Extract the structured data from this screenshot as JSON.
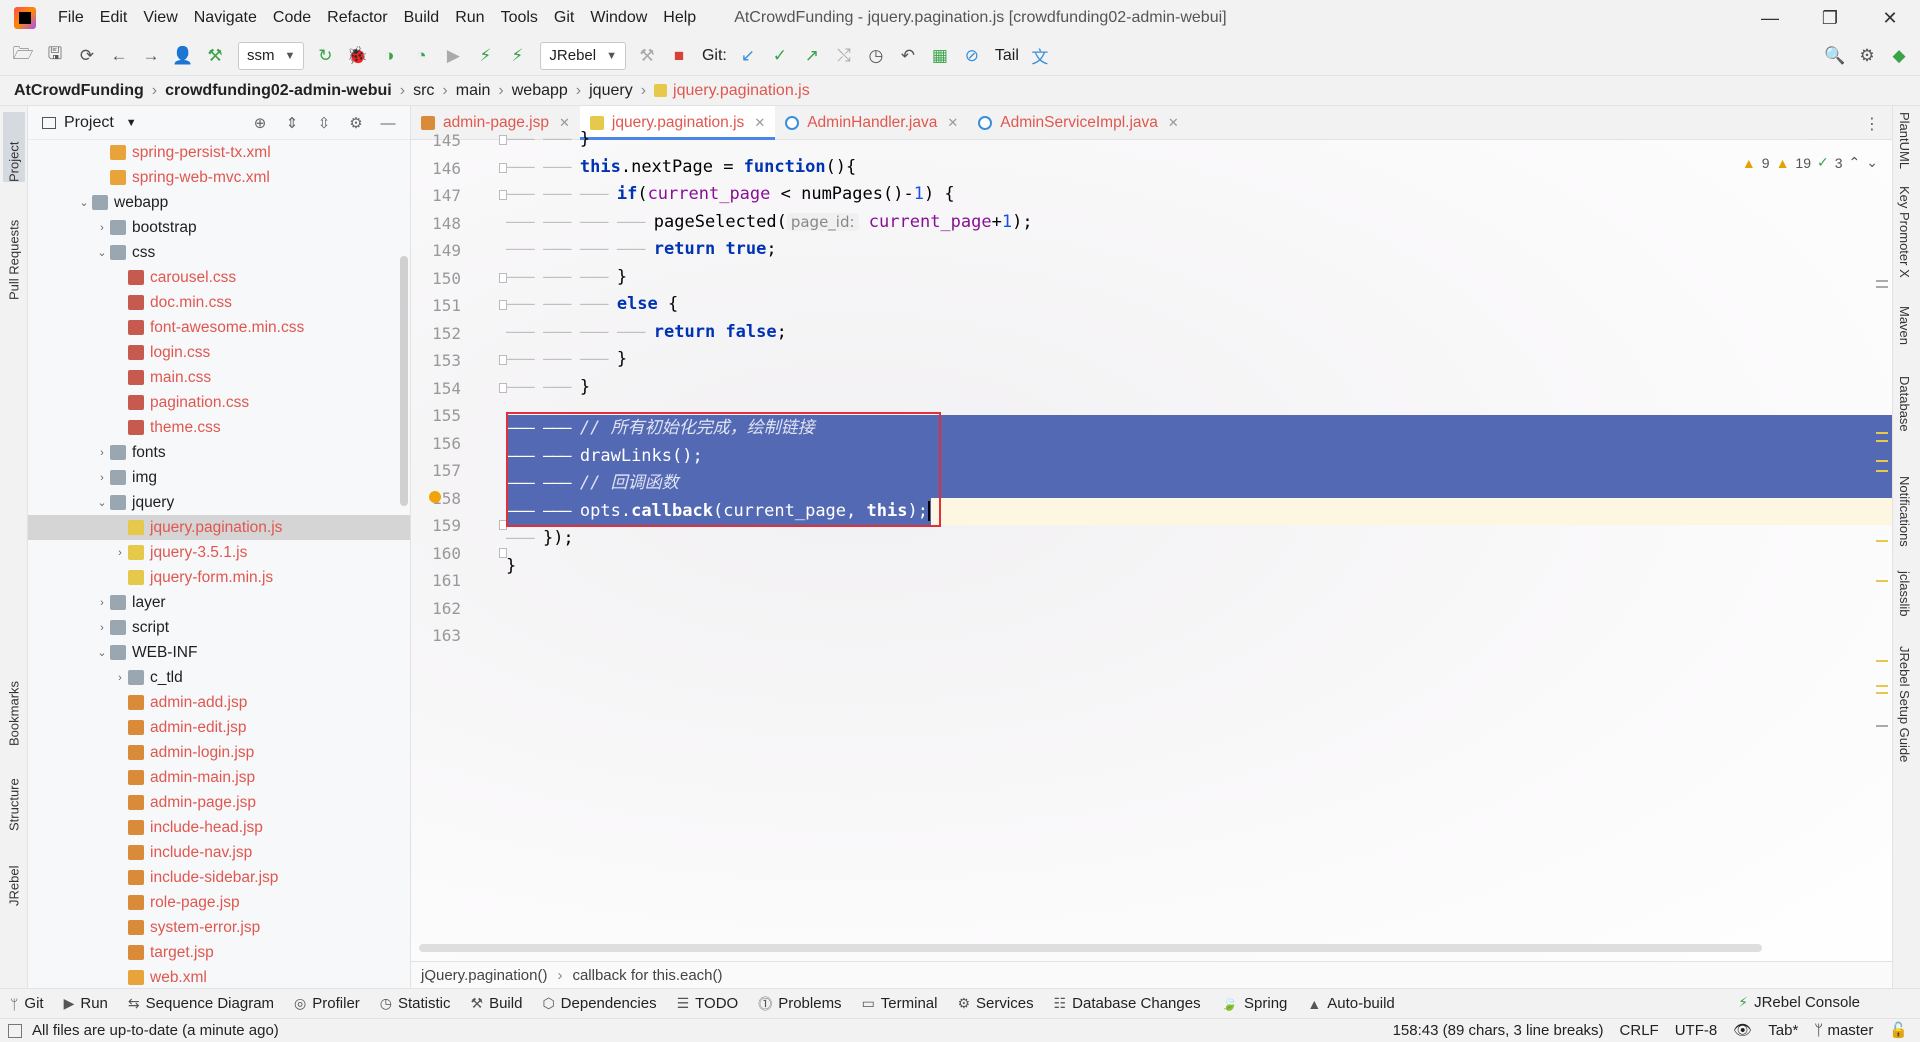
{
  "menubar": {
    "items": [
      "File",
      "Edit",
      "View",
      "Navigate",
      "Code",
      "Refactor",
      "Build",
      "Run",
      "Tools",
      "Git",
      "Window",
      "Help"
    ],
    "window_title": "AtCrowdFunding - jquery.pagination.js [crowdfunding02-admin-webui]"
  },
  "toolbar": {
    "run_config": "ssm",
    "jrebel": "JRebel",
    "git_label": "Git:",
    "tail_label": "Tail"
  },
  "breadcrumb": {
    "items": [
      "AtCrowdFunding",
      "crowdfunding02-admin-webui",
      "src",
      "main",
      "webapp",
      "jquery",
      "jquery.pagination.js"
    ]
  },
  "left_strip": {
    "project": "Project",
    "pull_requests": "Pull Requests",
    "bookmarks": "Bookmarks",
    "structure": "Structure",
    "jrebel": "JRebel"
  },
  "right_strip": {
    "items": [
      "PlantUML",
      "Key Promoter X",
      "Maven",
      "Database",
      "Notifications",
      "jclasslib",
      "JRebel Setup Guide"
    ]
  },
  "project_panel": {
    "title": "Project",
    "tree": [
      {
        "name": "spring-persist-tx.xml",
        "icon": "xml",
        "red": true
      },
      {
        "name": "spring-web-mvc.xml",
        "icon": "xml",
        "red": true
      },
      {
        "name": "webapp",
        "icon": "folder",
        "red": false,
        "arrow": "expanded"
      },
      {
        "name": "bootstrap",
        "icon": "folder",
        "red": false,
        "arrow": "collapsed"
      },
      {
        "name": "css",
        "icon": "folder",
        "red": false,
        "arrow": "expanded"
      },
      {
        "name": "carousel.css",
        "icon": "css",
        "red": true
      },
      {
        "name": "doc.min.css",
        "icon": "css",
        "red": true
      },
      {
        "name": "font-awesome.min.css",
        "icon": "css",
        "red": true
      },
      {
        "name": "login.css",
        "icon": "css",
        "red": true
      },
      {
        "name": "main.css",
        "icon": "css",
        "red": true
      },
      {
        "name": "pagination.css",
        "icon": "css",
        "red": true
      },
      {
        "name": "theme.css",
        "icon": "css",
        "red": true
      },
      {
        "name": "fonts",
        "icon": "folder",
        "red": false,
        "arrow": "collapsed"
      },
      {
        "name": "img",
        "icon": "folder",
        "red": false,
        "arrow": "collapsed"
      },
      {
        "name": "jquery",
        "icon": "folder",
        "red": false,
        "arrow": "expanded"
      },
      {
        "name": "jquery.pagination.js",
        "icon": "js",
        "red": true,
        "selected": true
      },
      {
        "name": "jquery-3.5.1.js",
        "icon": "js",
        "red": true,
        "arrow": "collapsed"
      },
      {
        "name": "jquery-form.min.js",
        "icon": "js",
        "red": true
      },
      {
        "name": "layer",
        "icon": "folder",
        "red": false,
        "arrow": "collapsed"
      },
      {
        "name": "script",
        "icon": "folder",
        "red": false,
        "arrow": "collapsed"
      },
      {
        "name": "WEB-INF",
        "icon": "folder",
        "red": false,
        "arrow": "expanded"
      },
      {
        "name": "c_tld",
        "icon": "folder",
        "red": false,
        "arrow": "collapsed"
      },
      {
        "name": "admin-add.jsp",
        "icon": "jsp",
        "red": true
      },
      {
        "name": "admin-edit.jsp",
        "icon": "jsp",
        "red": true
      },
      {
        "name": "admin-login.jsp",
        "icon": "jsp",
        "red": true
      },
      {
        "name": "admin-main.jsp",
        "icon": "jsp",
        "red": true
      },
      {
        "name": "admin-page.jsp",
        "icon": "jsp",
        "red": true
      },
      {
        "name": "include-head.jsp",
        "icon": "jsp",
        "red": true
      },
      {
        "name": "include-nav.jsp",
        "icon": "jsp",
        "red": true
      },
      {
        "name": "include-sidebar.jsp",
        "icon": "jsp",
        "red": true
      },
      {
        "name": "role-page.jsp",
        "icon": "jsp",
        "red": true
      },
      {
        "name": "system-error.jsp",
        "icon": "jsp",
        "red": true
      },
      {
        "name": "target.jsp",
        "icon": "jsp",
        "red": true
      },
      {
        "name": "web.xml",
        "icon": "xml",
        "red": true
      }
    ]
  },
  "editor": {
    "tabs": [
      {
        "label": "admin-page.jsp",
        "icon": "jsp",
        "active": false
      },
      {
        "label": "jquery.pagination.js",
        "icon": "js",
        "active": true
      },
      {
        "label": "AdminHandler.java",
        "icon": "java",
        "active": false
      },
      {
        "label": "AdminServiceImpl.java",
        "icon": "java",
        "active": false
      }
    ],
    "inspections": {
      "warnings": "9",
      "weak_warnings": "19",
      "ok": "3"
    },
    "line_numbers": [
      "145",
      "146",
      "147",
      "148",
      "149",
      "150",
      "151",
      "152",
      "153",
      "154",
      "155",
      "156",
      "157",
      "158",
      "159",
      "160",
      "161",
      "162",
      "163"
    ],
    "code": {
      "l145": "}",
      "l146_this": "this",
      "l146_prop": ".nextPage = ",
      "l146_fn": "function",
      "l146_rest": "(){",
      "l147_if": "if",
      "l147_rest1": "(",
      "l147_var": "current_page",
      "l147_rest2": " < numPages()-",
      "l147_num": "1",
      "l147_rest3": ") {",
      "l148_call": "pageSelected(",
      "l148_hint": "page_id:",
      "l148_var": " current_page",
      "l148_plus": "+",
      "l148_num": "1",
      "l148_end": ");",
      "l149_return": "return",
      "l149_true": "true",
      "l149_semi": ";",
      "l150": "}",
      "l151_else": "else",
      "l151_brace": " {",
      "l152_return": "return",
      "l152_false": "false",
      "l152_semi": ";",
      "l153": "}",
      "l154": "}",
      "l155": "// 所有初始化完成，绘制链接",
      "l156": "drawLinks();",
      "l157": "// 回调函数",
      "l158_a": "opts.",
      "l158_b": "callback",
      "l158_c": "(current_page, ",
      "l158_d": "this",
      "l158_e": ");",
      "l159": "});",
      "l160": "}"
    },
    "footer_breadcrumb": [
      "jQuery.pagination()",
      "callback for this.each()"
    ]
  },
  "bottom_tools": [
    "Git",
    "Run",
    "Sequence Diagram",
    "Profiler",
    "Statistic",
    "Build",
    "Dependencies",
    "TODO",
    "Problems",
    "Terminal",
    "Services",
    "Database Changes",
    "Spring",
    "Auto-build"
  ],
  "bottom_right_tool": "JRebel Console",
  "statusbar": {
    "message": "All files are up-to-date (a minute ago)",
    "position": "158:43 (89 chars, 3 line breaks)",
    "line_sep": "CRLF",
    "encoding": "UTF-8",
    "indent": "Tab*",
    "branch": "master"
  },
  "colors": {
    "selection": "#5469b3",
    "accent": "#4a86e8",
    "highlight_box": "#e0303a",
    "filename_red": "#e0574f"
  }
}
